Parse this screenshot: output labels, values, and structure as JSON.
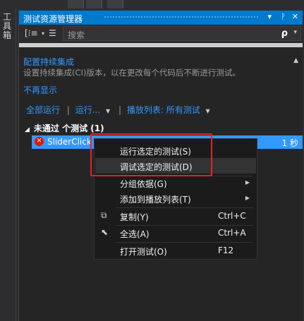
{
  "toolbox": {
    "label": "工具箱"
  },
  "window": {
    "title": "测试资源管理器",
    "controls": {
      "dropdown": "▾",
      "pin": "ᚹ",
      "close": "✕"
    }
  },
  "toolbar": {
    "group_icon": "[⁝≡",
    "group_caret": "▾",
    "playlist_icon": "☰",
    "search_placeholder": "搜索",
    "search_icon": "ρ",
    "search_caret": "▾"
  },
  "notice": {
    "title": "配置持续集成",
    "text": "设置持续集成(CI)版本，以在更改每个代码后不断进行测试。",
    "collapse": "▲",
    "dismiss": "不再显示"
  },
  "actions": {
    "run_all": "全部运行",
    "run": "运行...",
    "playlist": "播放列表: 所有测试",
    "separator": "|"
  },
  "test_group": {
    "label": "未通过 个测试 (1)",
    "toggle": "◢"
  },
  "test_item": {
    "name": "SliderClick",
    "duration": "1 秒",
    "status": "failed",
    "status_glyph": "✕"
  },
  "context_menu": {
    "items": [
      {
        "label": "运行选定的测试(S)"
      },
      {
        "label": "调试选定的测试(D)"
      },
      {
        "label": "分组依据(G)",
        "submenu": true
      },
      {
        "label": "添加到播放列表(T)",
        "submenu": true
      },
      {
        "label": "复制(Y)",
        "shortcut": "Ctrl+C",
        "icon": "copy-icon"
      },
      {
        "label": "全选(A)",
        "shortcut": "Ctrl+A",
        "icon": "select-all-icon"
      },
      {
        "label": "打开测试(O)",
        "shortcut": "F12"
      }
    ],
    "highlighted": "调试选定的测试(D)"
  },
  "colors": {
    "accent": "#007acc",
    "selection": "#3399ff",
    "link": "#3399ff",
    "annotation": "#e02424",
    "fail": "#e51400"
  }
}
